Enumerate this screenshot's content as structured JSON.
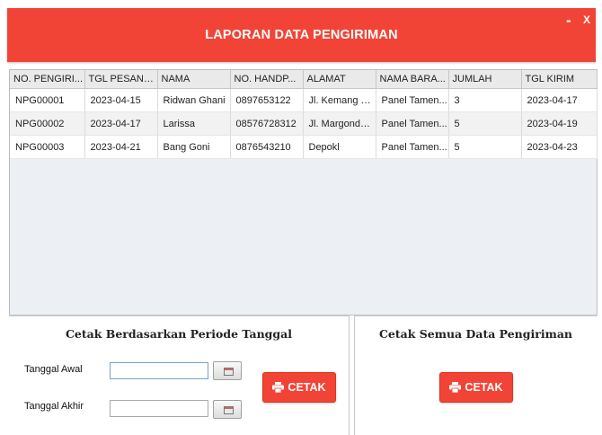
{
  "window": {
    "title": "LAPORAN DATA PENGIRIMAN",
    "minimize_label": "-",
    "close_label": "X"
  },
  "table": {
    "columns": [
      "NO. PENGIRI...",
      "TGL PESANAN",
      "NAMA",
      "NO. HANDP...",
      "ALAMAT",
      "NAMA BARA...",
      "JUMLAH",
      "TGL KIRIM"
    ],
    "rows": [
      [
        "NPG00001",
        "2023-04-15",
        "Ridwan Ghani",
        "0897653122",
        "Jl. Kemang R...",
        "Panel Tamen...",
        "3",
        "2023-04-17"
      ],
      [
        "NPG00002",
        "2023-04-17",
        "Larissa",
        "08576728312",
        "Jl. Margonda ...",
        "Panel Tamen...",
        "5",
        "2023-04-19"
      ],
      [
        "NPG00003",
        "2023-04-21",
        "Bang Goni",
        "0876543210",
        "Depokl",
        "Panel Tamen...",
        "5",
        "2023-04-23"
      ]
    ]
  },
  "period_panel": {
    "title": "Cetak Berdasarkan Periode Tanggal",
    "start_label": "Tanggal Awal",
    "start_value": "",
    "end_label": "Tanggal Akhir",
    "end_value": "",
    "print_label": "CETAK"
  },
  "all_panel": {
    "title": "Cetak Semua Data Pengiriman",
    "print_label": "CETAK"
  },
  "colors": {
    "accent": "#f14436",
    "table_bg": "#eceff3"
  },
  "icons": {
    "print": "printer-icon",
    "calendar": "calendar-icon"
  }
}
